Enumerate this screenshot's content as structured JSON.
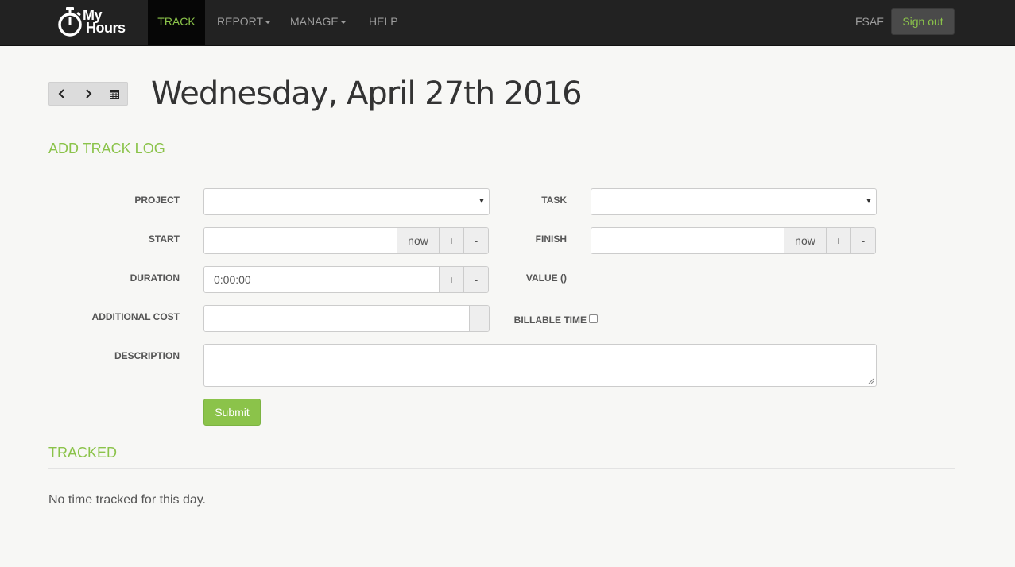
{
  "brand": {
    "line1": "My",
    "line2": "Hours"
  },
  "nav": {
    "items": [
      {
        "label": "TRACK",
        "active": true
      },
      {
        "label": "REPORT",
        "dropdown": true
      },
      {
        "label": "MANAGE",
        "dropdown": true
      },
      {
        "label": "HELP"
      }
    ],
    "user": "FSAF",
    "signout_label": "Sign out"
  },
  "page": {
    "date_title": "Wednesday, April 27th 2016"
  },
  "add_section": {
    "title": "ADD TRACK LOG"
  },
  "form": {
    "project_label": "PROJECT",
    "task_label": "TASK",
    "start_label": "START",
    "finish_label": "FINISH",
    "duration_label": "DURATION",
    "duration_value": "0:00:00",
    "value_label": "VALUE ()",
    "additional_cost_label": "ADDITIONAL COST",
    "billable_label": "BILLABLE TIME",
    "description_label": "DESCRIPTION",
    "now_label": "now",
    "plus_label": "+",
    "minus_label": "-",
    "submit_label": "Submit"
  },
  "tracked_section": {
    "title": "TRACKED",
    "empty_message": "No time tracked for this day."
  },
  "colors": {
    "accent": "#8bc34a",
    "navbar": "#222222"
  }
}
